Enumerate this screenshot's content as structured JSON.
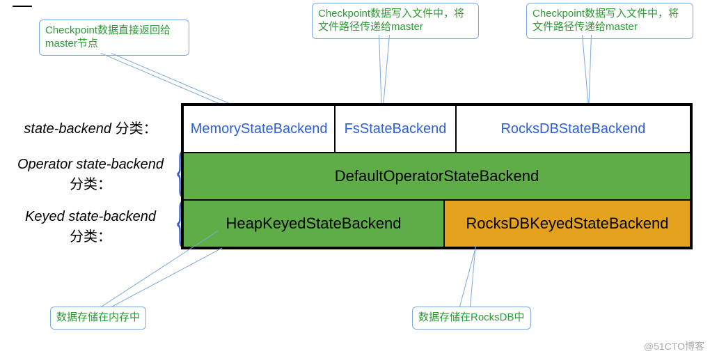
{
  "callouts": {
    "top1": "Checkpoint数据直接返回给master节点",
    "top2": "Checkpoint数据写入文件中，将文件路径传递给master",
    "top3": "Checkpoint数据写入文件中，将文件路径传递给master",
    "bottom1": "数据存储在内存中",
    "bottom2": "数据存储在RocksDB中"
  },
  "labels": {
    "row1_a": "state-backend",
    "row1_b": "分类：",
    "row2_a": "Operator state-backend",
    "row2_b": "分类：",
    "row3_a": "Keyed state-backend",
    "row3_b": "分类："
  },
  "cells": {
    "memory": "MemoryStateBackend",
    "fs": "FsStateBackend",
    "rocks": "RocksDBStateBackend",
    "defaultOp": "DefaultOperatorStateBackend",
    "heapKeyed": "HeapKeyedStateBackend",
    "rocksKeyed": "RocksDBKeyedStateBackend"
  },
  "watermark": "@51CTO博客"
}
